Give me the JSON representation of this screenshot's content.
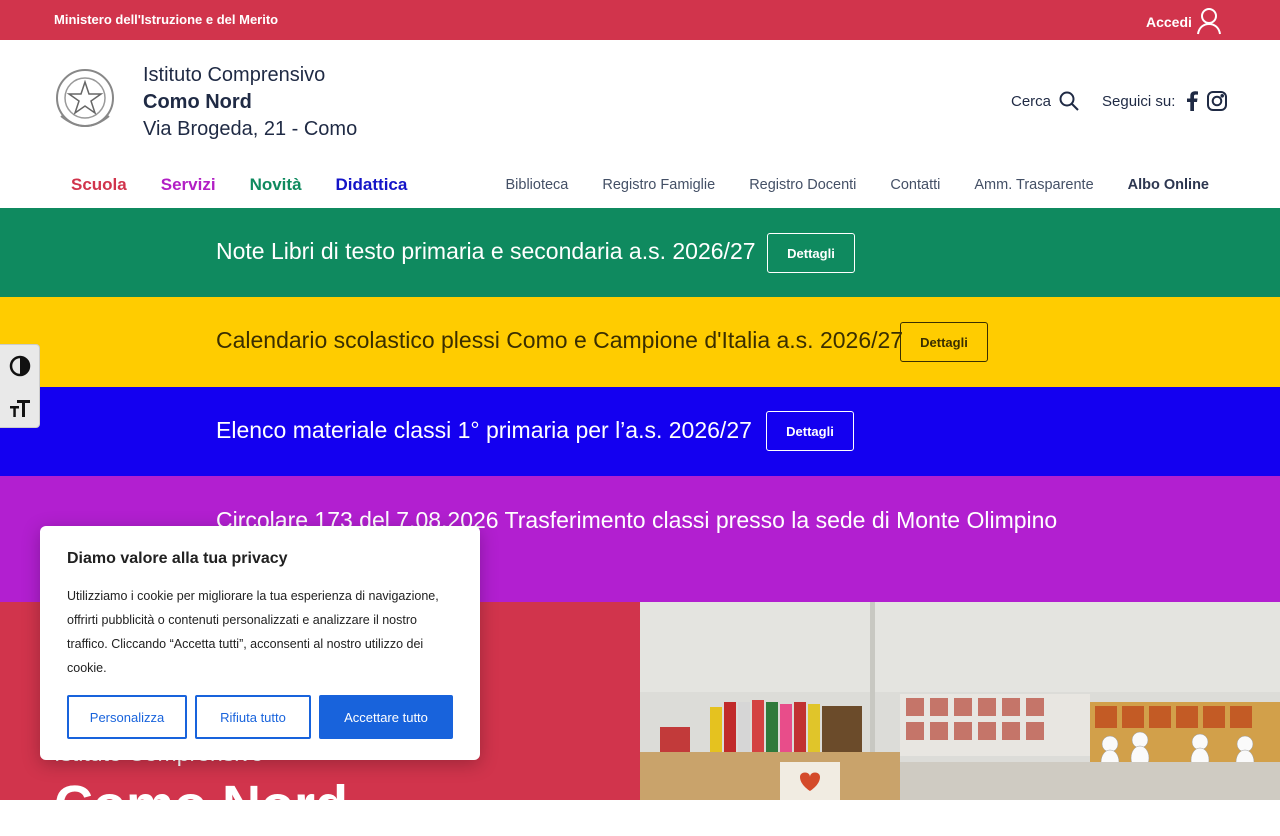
{
  "topbar": {
    "ministry": "Ministero dell'Istruzione e del Merito",
    "login": "Accedi"
  },
  "header": {
    "line1": "Istituto Comprensivo",
    "line2": "Como Nord",
    "line3": "Via Brogeda, 21 - Como",
    "search": "Cerca",
    "follow": "Seguici su:"
  },
  "mainnav": [
    {
      "label": "Scuola",
      "color": "#d1344c"
    },
    {
      "label": "Servizi",
      "color": "#b21fc5"
    },
    {
      "label": "Novità",
      "color": "#0f8a5f"
    },
    {
      "label": "Didattica",
      "color": "#1414c8"
    }
  ],
  "secnav": [
    "Biblioteca",
    "Registro Famiglie",
    "Registro Docenti",
    "Contatti",
    "Amm. Trasparente",
    "Albo Online"
  ],
  "bands": [
    {
      "text": "Note Libri di testo primaria e secondaria a.s. 2026/27",
      "button": "Dettagli",
      "bg": "#0f8a5f",
      "fg": "#ffffff"
    },
    {
      "text": "Calendario scolastico plessi Como e Campione d'Italia a.s. 2026/27",
      "button": "Dettagli",
      "bg": "#ffcc00",
      "fg": "#3a2e00"
    },
    {
      "text": "Elenco materiale classi 1° primaria per l’a.s. 2026/27",
      "button": "Dettagli",
      "bg": "#1400f0",
      "fg": "#ffffff"
    },
    {
      "text": "Circolare 173 del 7.08.2026 Trasferimento classi presso la sede di Monte Olimpino",
      "button": "",
      "bg": "#b21fd0",
      "fg": "#ffffff"
    }
  ],
  "hero": {
    "sub": "Istituto Comprensivo",
    "big": "Como Nord"
  },
  "cookie": {
    "title": "Diamo valore alla tua privacy",
    "body": "Utilizziamo i cookie per migliorare la tua esperienza di navigazione, offrirti pubblicità o contenuti personalizzati e analizzare il nostro traffico. Cliccando “Accetta tutti”, acconsenti al nostro utilizzo dei cookie.",
    "customize": "Personalizza",
    "reject": "Rifiuta tutto",
    "accept": "Accettare tutto"
  },
  "icons": {
    "user": "user-icon",
    "search": "search-icon",
    "facebook": "facebook-icon",
    "instagram": "instagram-icon",
    "contrast": "contrast-icon",
    "textsize": "text-size-icon",
    "emblem": "emblem-icon"
  }
}
